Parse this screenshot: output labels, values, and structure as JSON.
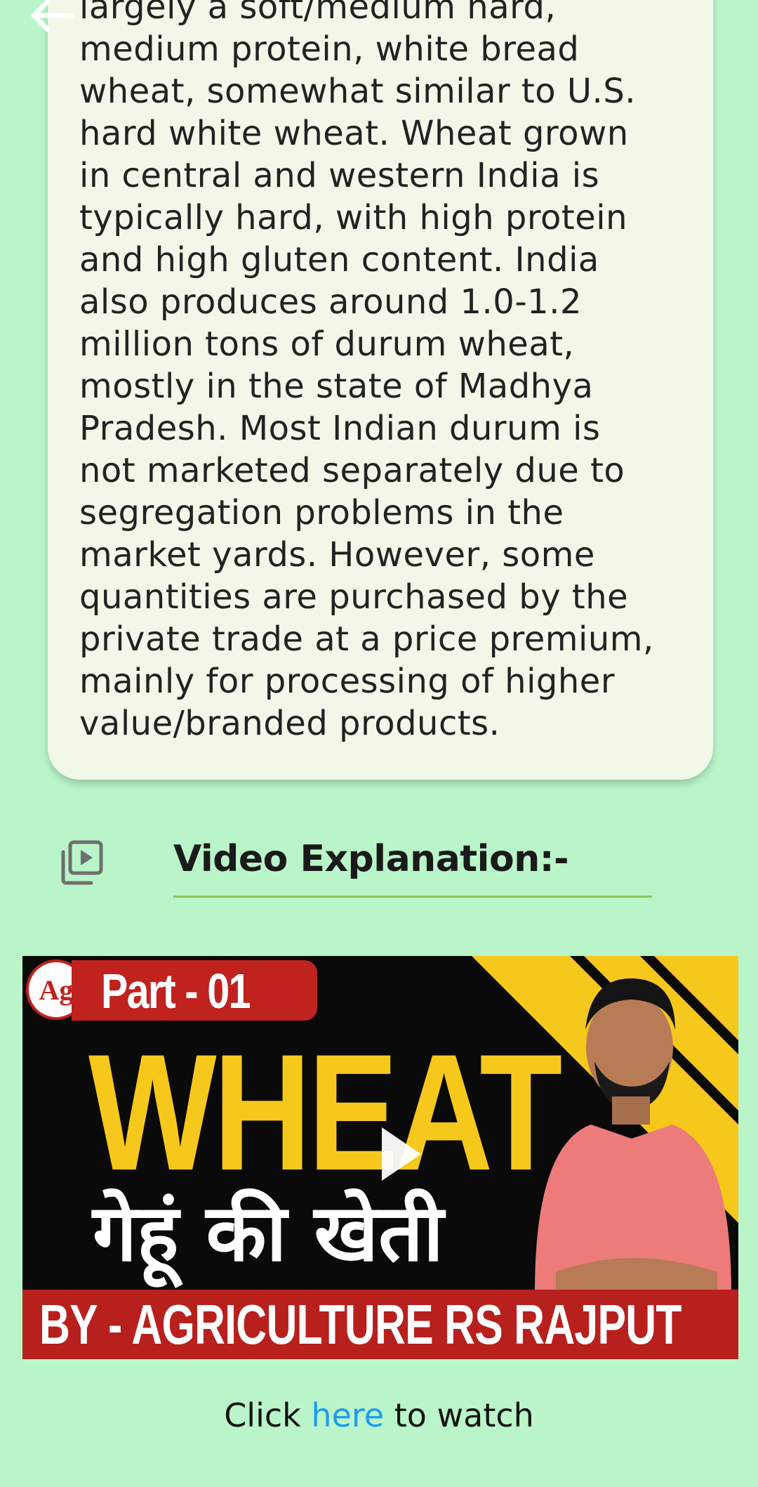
{
  "nav": {
    "back_icon": "arrow-left-icon"
  },
  "article": {
    "lines": [
      "largely a soft/medium hard,",
      "medium protein, white bread",
      "wheat, somewhat similar to U.S.",
      "hard white wheat. Wheat grown",
      "in central and western India is",
      "typically hard, with high protein",
      "and high gluten content. India",
      "also produces around 1.0-1.2",
      "million tons of durum wheat,",
      "mostly in the state of Madhya",
      "Pradesh. Most Indian durum is",
      "not marketed separately due to",
      "segregation problems in the",
      "market yards. However, some",
      "quantities are purchased by the",
      "private trade at a price premium,",
      "mainly for processing of higher",
      "value/branded products."
    ]
  },
  "video_section": {
    "icon": "video-library-icon",
    "title": "Video Explanation:-",
    "thumbnail": {
      "logo_text": "Ag",
      "part_label": "Part - 01",
      "headline": "WHEAT",
      "hindi_subtitle": "गेहूं की खेती",
      "byline": "BY - AGRICULTURE RS RAJPUT",
      "play_icon": "play-icon"
    },
    "watch_prefix": "Click ",
    "watch_link": "here",
    "watch_suffix": " to watch"
  },
  "colors": {
    "page_background": "#b9f5c9",
    "card_background": "#f1f7e9",
    "underline": "#8dc45a",
    "link": "#1e9bf0",
    "thumb_yellow": "#f7c81c",
    "thumb_red": "#b8201d"
  }
}
